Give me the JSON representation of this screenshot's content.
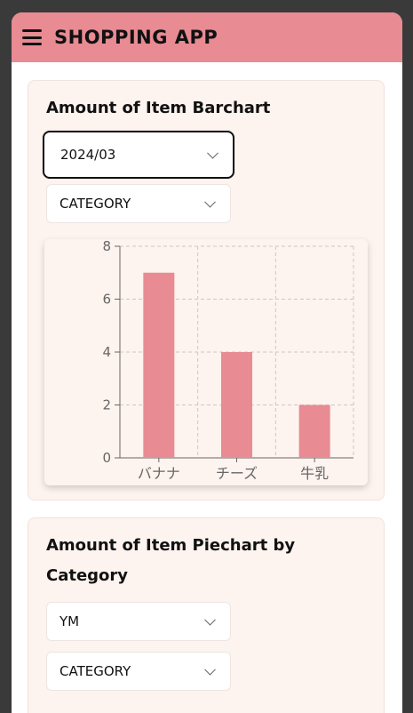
{
  "header": {
    "title": "SHOPPING APP",
    "menu_icon": "menu-icon"
  },
  "barchart_card": {
    "title": "Amount of Item Barchart",
    "select_month": "2024/03",
    "select_group": "CATEGORY"
  },
  "piechart_card": {
    "title": "Amount of Item Piechart by Category",
    "select_month": "YM",
    "select_group": "CATEGORY"
  },
  "chart_data": {
    "type": "bar",
    "categories": [
      "バナナ",
      "チーズ",
      "牛乳"
    ],
    "values": [
      7,
      4,
      2
    ],
    "ylim": [
      0,
      8
    ],
    "yticks": [
      0,
      2,
      4,
      6,
      8
    ],
    "grid": true,
    "bar_color": "#e88b93"
  },
  "colors": {
    "accent": "#e88b93",
    "card_bg": "#fdf3ef"
  }
}
